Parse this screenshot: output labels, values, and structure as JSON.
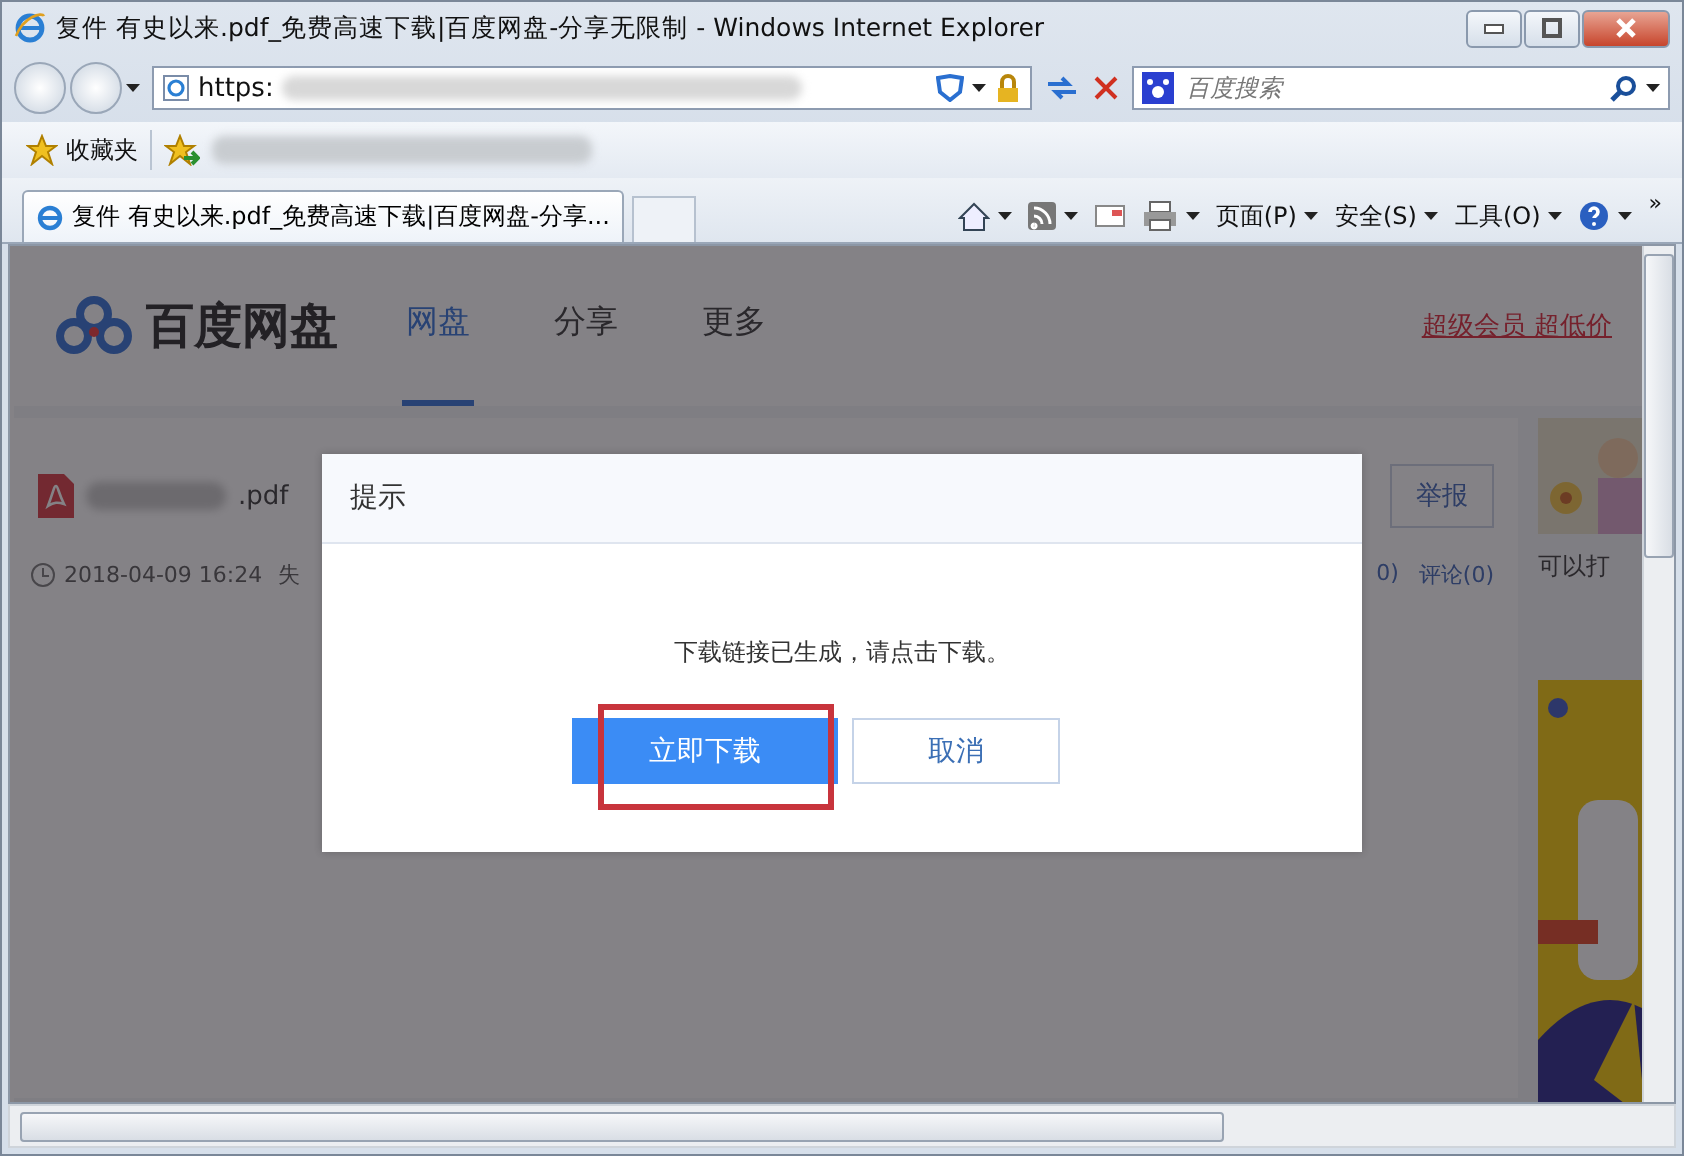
{
  "window": {
    "title": "复件 有史以来.pdf_免费高速下载|百度网盘-分享无限制 - Windows Internet Explorer"
  },
  "address_bar": {
    "value": "https:"
  },
  "search": {
    "placeholder": "百度搜索"
  },
  "favorites_bar": {
    "label": "收藏夹"
  },
  "tabs": [
    {
      "label": "复件 有史以来.pdf_免费高速下载|百度网盘-分享...",
      "selected": true
    }
  ],
  "command_bar": {
    "menus": [
      "页面(P)",
      "安全(S)",
      "工具(O)"
    ],
    "overflow": "»"
  },
  "page": {
    "logo": "百度网盘",
    "nav": [
      {
        "label": "网盘",
        "selected": true
      },
      {
        "label": "分享",
        "selected": false
      },
      {
        "label": "更多",
        "selected": false
      }
    ],
    "promo_link": "超级会员 超低价",
    "file": {
      "name_suffix": ".pdf",
      "date": "2018-04-09 16:24",
      "cut_text": "失",
      "report_button": "举报",
      "counts": [
        "0)",
        "评论(0)"
      ]
    },
    "sidebar": {
      "caption": "可以打"
    }
  },
  "dialog": {
    "title": "提示",
    "message": "下载链接已生成，请点击下载。",
    "buttons": [
      {
        "label": "立即下载",
        "kind": "primary",
        "highlighted": true
      },
      {
        "label": "取消",
        "kind": "secondary",
        "highlighted": false
      }
    ]
  }
}
